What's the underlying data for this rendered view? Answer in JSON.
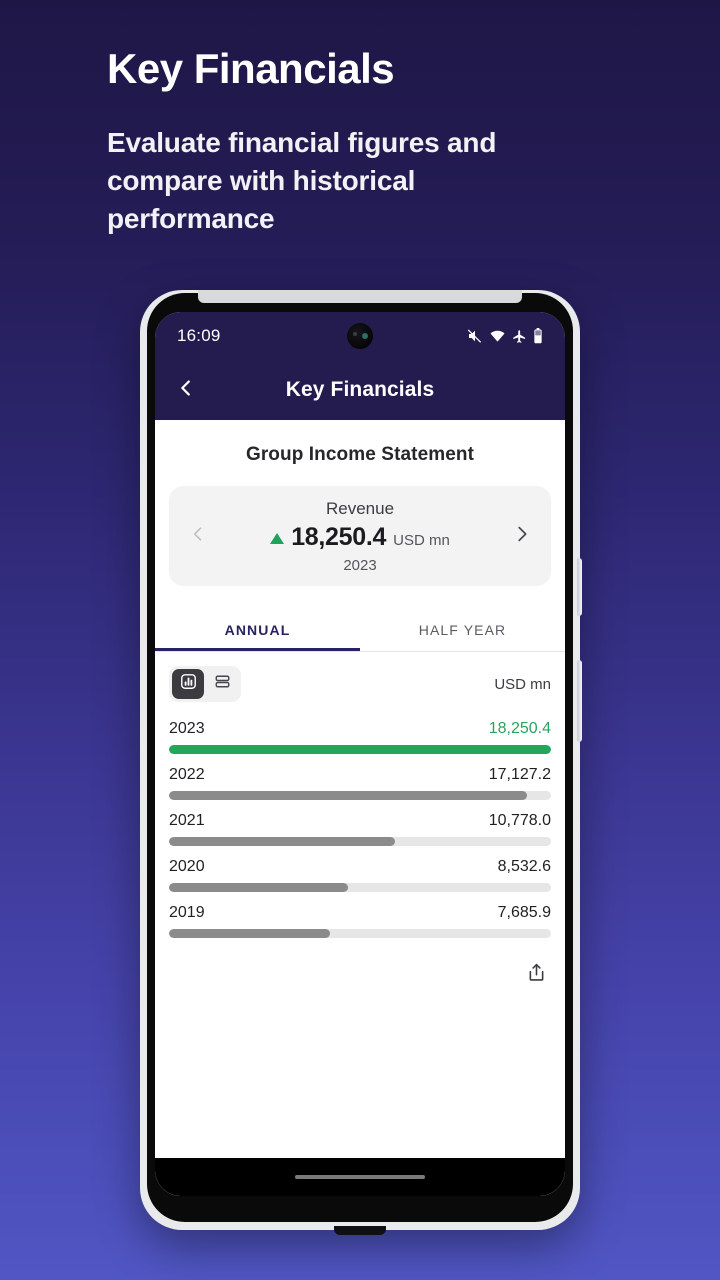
{
  "promo": {
    "title": "Key Financials",
    "subtitle": "Evaluate financial figures and compare with historical performance"
  },
  "phone": {
    "statusbar": {
      "time": "16:09",
      "icons": [
        "mute-icon",
        "wifi-icon",
        "airplane-mode-icon",
        "battery-icon"
      ]
    },
    "appbar": {
      "back_icon": "chevron-left-icon",
      "title": "Key Financials"
    }
  },
  "screen": {
    "section_title": "Group Income Statement",
    "metric_card": {
      "prev_icon": "chevron-left-icon",
      "next_icon": "chevron-right-icon",
      "label": "Revenue",
      "trend_icon": "triangle-up-icon",
      "value": "18,250.4",
      "unit": "USD mn",
      "period": "2023"
    },
    "tabs": [
      {
        "label": "ANNUAL",
        "active": true
      },
      {
        "label": "HALF YEAR",
        "active": false
      }
    ],
    "toolbar": {
      "view_chart_icon": "bar-chart-icon",
      "view_list_icon": "list-view-icon",
      "unit": "USD mn"
    },
    "share_icon": "share-icon"
  },
  "colors": {
    "brand_navy": "#241c4f",
    "tab_active": "#272262",
    "positive_green": "#2aa35f",
    "bar_green": "#22a75a",
    "bar_gray": "#8b8b8b",
    "bar_track": "#e6e6e7"
  },
  "chart_data": {
    "type": "bar",
    "title": "Revenue",
    "orientation": "horizontal",
    "unit": "USD mn",
    "xlabel": "",
    "ylabel": "",
    "grid": false,
    "legend": null,
    "categories": [
      "2023",
      "2022",
      "2021",
      "2020",
      "2019"
    ],
    "values": [
      18250.4,
      17127.2,
      10778.0,
      8532.6,
      7685.9
    ],
    "labels": [
      "18,250.4",
      "17,127.2",
      "10,778.0",
      "8,532.6",
      "7,685.9"
    ],
    "percents": [
      100,
      93.8,
      59.1,
      46.8,
      42.1
    ],
    "bar_colors": [
      "#22a75a",
      "#8b8b8b",
      "#8b8b8b",
      "#8b8b8b",
      "#8b8b8b"
    ],
    "label_colors": [
      "#2aa35f",
      "#1f1f24",
      "#1f1f24",
      "#1f1f24",
      "#1f1f24"
    ],
    "ylim": [
      0,
      18250.4
    ]
  }
}
